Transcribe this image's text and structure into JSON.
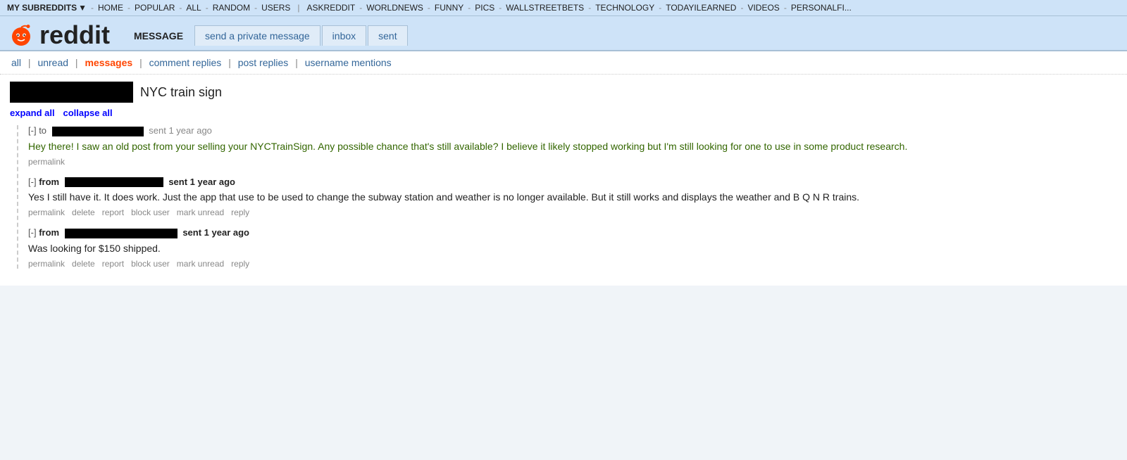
{
  "topnav": {
    "my_subreddits": "MY SUBREDDITS",
    "home": "HOME",
    "links": [
      "POPULAR",
      "ALL",
      "RANDOM",
      "USERS",
      "ASKREDDIT",
      "WORLDNEWS",
      "FUNNY",
      "PICS",
      "WALLSTREETBETS",
      "TECHNOLOGY",
      "TODAYILEARNED",
      "VIDEOS",
      "PERSONALFI"
    ]
  },
  "header": {
    "logo_text": "reddit",
    "tabs": {
      "message": "MESSAGE",
      "send_private": "send a private message",
      "inbox": "inbox",
      "sent": "sent"
    }
  },
  "subnav": {
    "all": "all",
    "unread": "unread",
    "messages": "messages",
    "comment_replies": "comment replies",
    "post_replies": "post replies",
    "username_mentions": "username mentions"
  },
  "thread": {
    "title": "NYC train sign",
    "expand_all": "expand all",
    "collapse_all": "collapse all"
  },
  "messages": [
    {
      "id": "msg1",
      "type": "to",
      "bracket": "[-]",
      "direction_label": "to",
      "redacted_width": 130,
      "timestamp": "sent 1 year ago",
      "bold_timestamp": false,
      "body_type": "green",
      "body": "Hey there! I saw an old post from your selling your NYCTrainSign. Any possible chance that’s still available? I believe it likely stopped working but I’m still looking for one to use in some product research.",
      "actions": [
        "permalink"
      ]
    },
    {
      "id": "msg2",
      "type": "from",
      "bracket": "[-]",
      "direction_label": "from",
      "redacted_width": 140,
      "timestamp": "sent 1 year ago",
      "bold_timestamp": true,
      "body_type": "black",
      "body": "Yes I still have it. It does work. Just the app that use to be used to change the subway station and weather is no longer available. But it still works and displays the weather and B Q N R trains.",
      "actions": [
        "permalink",
        "delete",
        "report",
        "block user",
        "mark unread",
        "reply"
      ]
    },
    {
      "id": "msg3",
      "type": "from",
      "bracket": "[-]",
      "direction_label": "from",
      "redacted_width": 160,
      "timestamp": "sent 1 year ago",
      "bold_timestamp": true,
      "body_type": "black",
      "body": "Was looking for $150 shipped.",
      "actions": [
        "permalink",
        "delete",
        "report",
        "block user",
        "mark unread",
        "reply"
      ]
    }
  ]
}
